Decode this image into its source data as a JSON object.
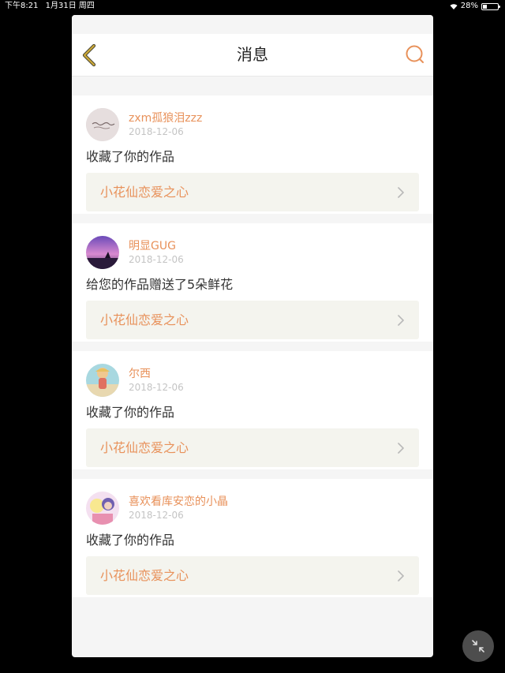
{
  "status_bar": {
    "time": "下午8:21",
    "date": "1月31日 周四",
    "battery": "28%",
    "battery_level": 0.28
  },
  "nav": {
    "title": "消息",
    "back_icon": "chevron-left-icon",
    "search_icon": "search-icon"
  },
  "colors": {
    "accent": "#e8915a",
    "back_icon": "#c9a63a",
    "link_bg": "#f4f4ee"
  },
  "messages": [
    {
      "user": "zxm孤狼泪zzz",
      "date": "2018-12-06",
      "text": "收藏了你的作品",
      "work": "小花仙恋爱之心"
    },
    {
      "user": "明显GUG",
      "date": "2018-12-06",
      "text": "给您的作品赠送了5朵鲜花",
      "work": "小花仙恋爱之心"
    },
    {
      "user": "尔西",
      "date": "2018-12-06",
      "text": "收藏了你的作品",
      "work": "小花仙恋爱之心"
    },
    {
      "user": "喜欢看库安恋的小晶",
      "date": "2018-12-06",
      "text": "收藏了你的作品",
      "work": "小花仙恋爱之心"
    }
  ]
}
